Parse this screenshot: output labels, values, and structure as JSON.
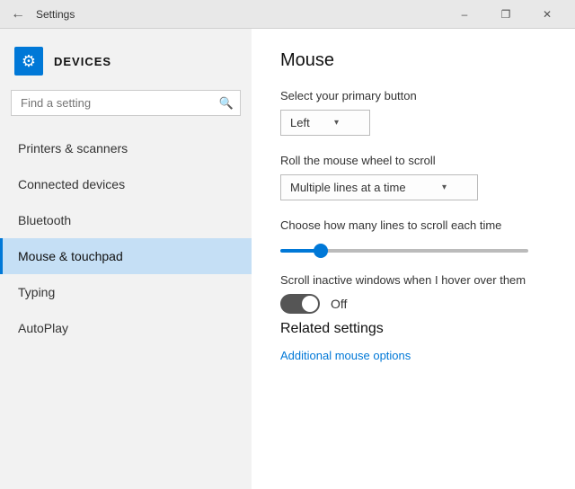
{
  "titlebar": {
    "back_icon": "←",
    "title": "Settings",
    "min_label": "–",
    "restore_label": "❐",
    "close_label": "✕"
  },
  "sidebar": {
    "icon_symbol": "⚙",
    "section_title": "DEVICES",
    "search_placeholder": "Find a setting",
    "search_icon": "🔍",
    "nav_items": [
      {
        "id": "printers",
        "label": "Printers & scanners",
        "active": false
      },
      {
        "id": "connected",
        "label": "Connected devices",
        "active": false
      },
      {
        "id": "bluetooth",
        "label": "Bluetooth",
        "active": false
      },
      {
        "id": "mouse",
        "label": "Mouse & touchpad",
        "active": true
      },
      {
        "id": "typing",
        "label": "Typing",
        "active": false
      },
      {
        "id": "autoplay",
        "label": "AutoPlay",
        "active": false
      }
    ]
  },
  "content": {
    "page_title": "Mouse",
    "primary_button_label": "Select your primary button",
    "primary_button_value": "Left",
    "scroll_wheel_label": "Roll the mouse wheel to scroll",
    "scroll_wheel_value": "Multiple lines at a time",
    "scroll_lines_label": "Choose how many lines to scroll each time",
    "slider_value": 15,
    "inactive_scroll_label": "Scroll inactive windows when I hover over them",
    "toggle_state": "Off",
    "related_title": "Related settings",
    "additional_link": "Additional mouse options"
  }
}
